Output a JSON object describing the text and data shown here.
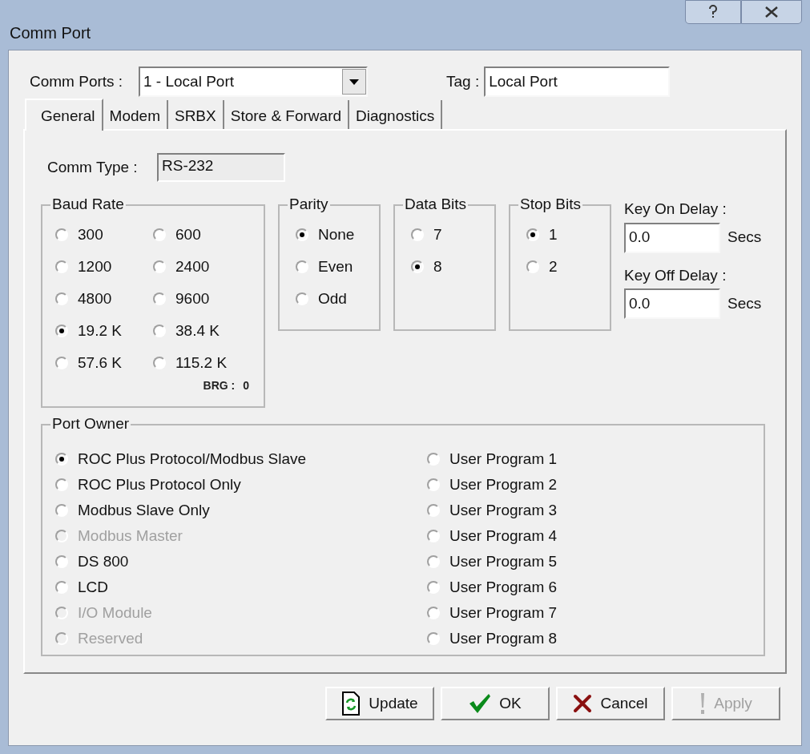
{
  "window": {
    "title": "Comm Port"
  },
  "comm_ports": {
    "label": "Comm Ports :",
    "value": "1 - Local Port"
  },
  "tag": {
    "label": "Tag :",
    "value": "Local Port"
  },
  "tabs": [
    {
      "label": "General",
      "selected": true
    },
    {
      "label": "Modem",
      "selected": false
    },
    {
      "label": "SRBX",
      "selected": false
    },
    {
      "label": "Store & Forward",
      "selected": false
    },
    {
      "label": "Diagnostics",
      "selected": false
    }
  ],
  "comm_type": {
    "label": "Comm Type :",
    "value": "RS-232"
  },
  "baud_rate": {
    "title": "Baud Rate",
    "options": [
      {
        "label": "300",
        "selected": false
      },
      {
        "label": "600",
        "selected": false
      },
      {
        "label": "1200",
        "selected": false
      },
      {
        "label": "2400",
        "selected": false
      },
      {
        "label": "4800",
        "selected": false
      },
      {
        "label": "9600",
        "selected": false
      },
      {
        "label": "19.2 K",
        "selected": true
      },
      {
        "label": "38.4 K",
        "selected": false
      },
      {
        "label": "57.6 K",
        "selected": false
      },
      {
        "label": "115.2 K",
        "selected": false
      }
    ],
    "brg_label": "BRG :",
    "brg_value": "0"
  },
  "parity": {
    "title": "Parity",
    "options": [
      {
        "label": "None",
        "selected": true
      },
      {
        "label": "Even",
        "selected": false
      },
      {
        "label": "Odd",
        "selected": false
      }
    ]
  },
  "data_bits": {
    "title": "Data Bits",
    "options": [
      {
        "label": "7",
        "selected": false
      },
      {
        "label": "8",
        "selected": true
      }
    ]
  },
  "stop_bits": {
    "title": "Stop Bits",
    "options": [
      {
        "label": "1",
        "selected": true
      },
      {
        "label": "2",
        "selected": false
      }
    ]
  },
  "key_on_delay": {
    "label": "Key On Delay :",
    "value": "0.0",
    "unit": "Secs"
  },
  "key_off_delay": {
    "label": "Key Off Delay :",
    "value": "0.0",
    "unit": "Secs"
  },
  "port_owner": {
    "title": "Port Owner",
    "columns": [
      [
        {
          "label": "ROC Plus Protocol/Modbus Slave",
          "selected": true,
          "disabled": false
        },
        {
          "label": "ROC Plus Protocol Only",
          "selected": false,
          "disabled": false
        },
        {
          "label": "Modbus Slave Only",
          "selected": false,
          "disabled": false
        },
        {
          "label": "Modbus Master",
          "selected": false,
          "disabled": true
        },
        {
          "label": "DS 800",
          "selected": false,
          "disabled": false
        },
        {
          "label": "LCD",
          "selected": false,
          "disabled": false
        },
        {
          "label": "I/O Module",
          "selected": false,
          "disabled": true
        },
        {
          "label": "Reserved",
          "selected": false,
          "disabled": true
        }
      ],
      [
        {
          "label": "User Program 1",
          "selected": false,
          "disabled": false
        },
        {
          "label": "User Program 2",
          "selected": false,
          "disabled": false
        },
        {
          "label": "User Program 3",
          "selected": false,
          "disabled": false
        },
        {
          "label": "User Program 4",
          "selected": false,
          "disabled": false
        },
        {
          "label": "User Program 5",
          "selected": false,
          "disabled": false
        },
        {
          "label": "User Program 6",
          "selected": false,
          "disabled": false
        },
        {
          "label": "User Program 7",
          "selected": false,
          "disabled": false
        },
        {
          "label": "User Program 8",
          "selected": false,
          "disabled": false
        }
      ]
    ]
  },
  "buttons": [
    {
      "kind": "update",
      "label": "Update",
      "disabled": false
    },
    {
      "kind": "ok",
      "label": "OK",
      "disabled": false
    },
    {
      "kind": "cancel",
      "label": "Cancel",
      "disabled": false
    },
    {
      "kind": "apply",
      "label": "Apply",
      "disabled": true
    }
  ]
}
